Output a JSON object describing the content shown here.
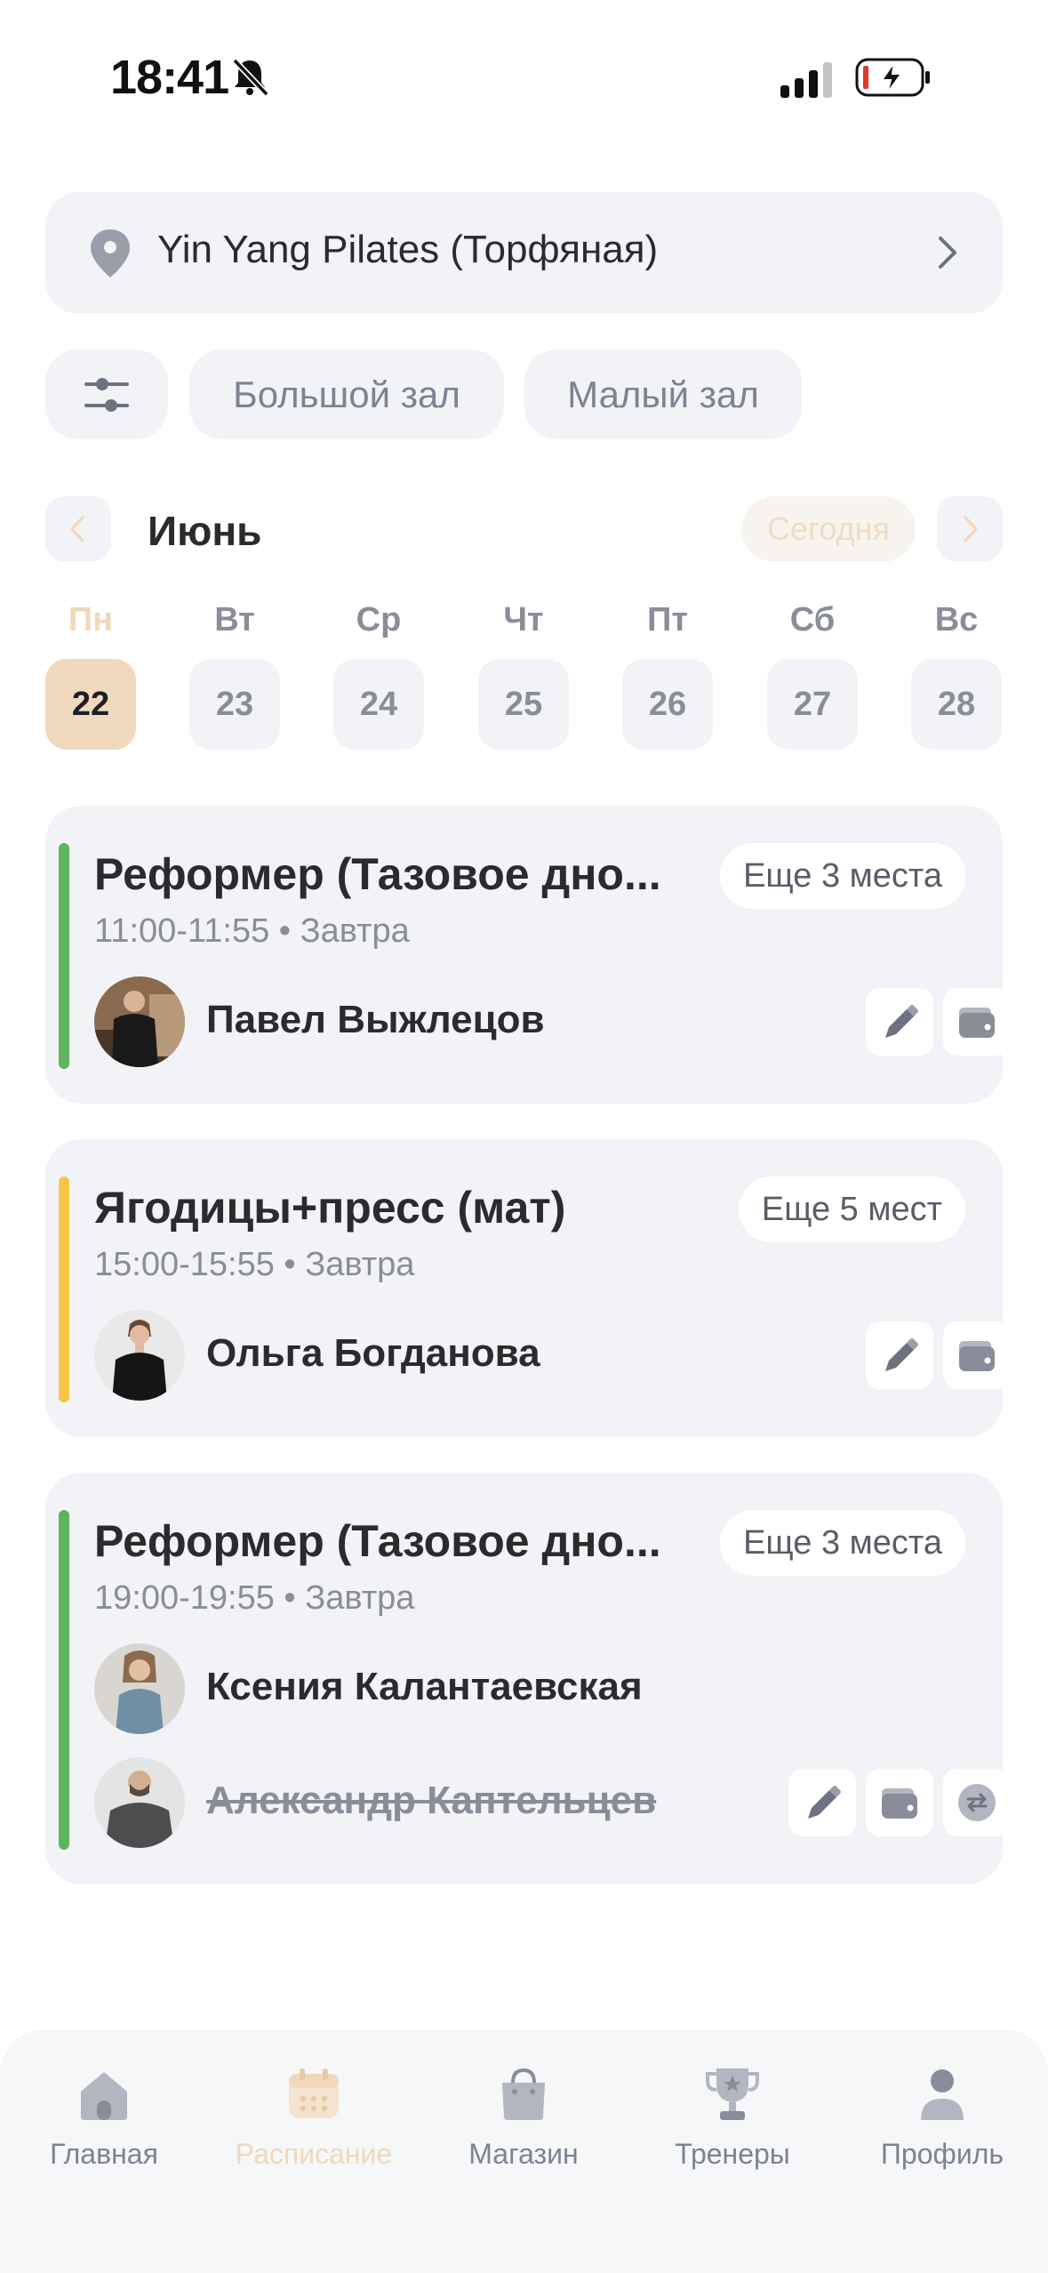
{
  "status_bar": {
    "time": "18:41"
  },
  "location": {
    "name": "Yin Yang Pilates (Торфяная)"
  },
  "halls": [
    "Большой зал",
    "Малый зал"
  ],
  "calendar": {
    "month": "Июнь",
    "today_label": "Сегодня",
    "weekdays": [
      "Пн",
      "Вт",
      "Ср",
      "Чт",
      "Пт",
      "Сб",
      "Вс"
    ],
    "days": [
      "22",
      "23",
      "24",
      "25",
      "26",
      "27",
      "28"
    ],
    "selected_index": 0
  },
  "classes": [
    {
      "title": "Реформер (Тазовое дно...",
      "seats": "Еще 3 места",
      "time": "11:00-11:55",
      "day": "Завтра",
      "accent": "#5cb55e",
      "trainers": [
        {
          "name": "Павел Выжлецов",
          "cancelled": false
        }
      ]
    },
    {
      "title": "Ягодицы+пресс (мат)",
      "seats": "Еще 5 мест",
      "time": "15:00-15:55",
      "day": "Завтра",
      "accent": "#f6c54a",
      "trainers": [
        {
          "name": "Ольга Богданова",
          "cancelled": false
        }
      ]
    },
    {
      "title": "Реформер (Тазовое дно...",
      "seats": "Еще 3 места",
      "time": "19:00-19:55",
      "day": "Завтра",
      "accent": "#5cb55e",
      "trainers": [
        {
          "name": "Ксения Калантаевская",
          "cancelled": false
        },
        {
          "name": "Александр Каптельцев",
          "cancelled": true
        }
      ]
    }
  ],
  "tabs": [
    {
      "label": "Главная",
      "icon": "home-icon"
    },
    {
      "label": "Расписание",
      "icon": "calendar-icon",
      "active": true
    },
    {
      "label": "Магазин",
      "icon": "shopping-bag-icon"
    },
    {
      "label": "Тренеры",
      "icon": "trophy-icon"
    },
    {
      "label": "Профиль",
      "icon": "profile-icon"
    }
  ],
  "colors": {
    "accent": "#f0d9bd",
    "card_bg": "#f2f3f7",
    "green_bar": "#5cb55e",
    "yellow_bar": "#f6c54a"
  }
}
